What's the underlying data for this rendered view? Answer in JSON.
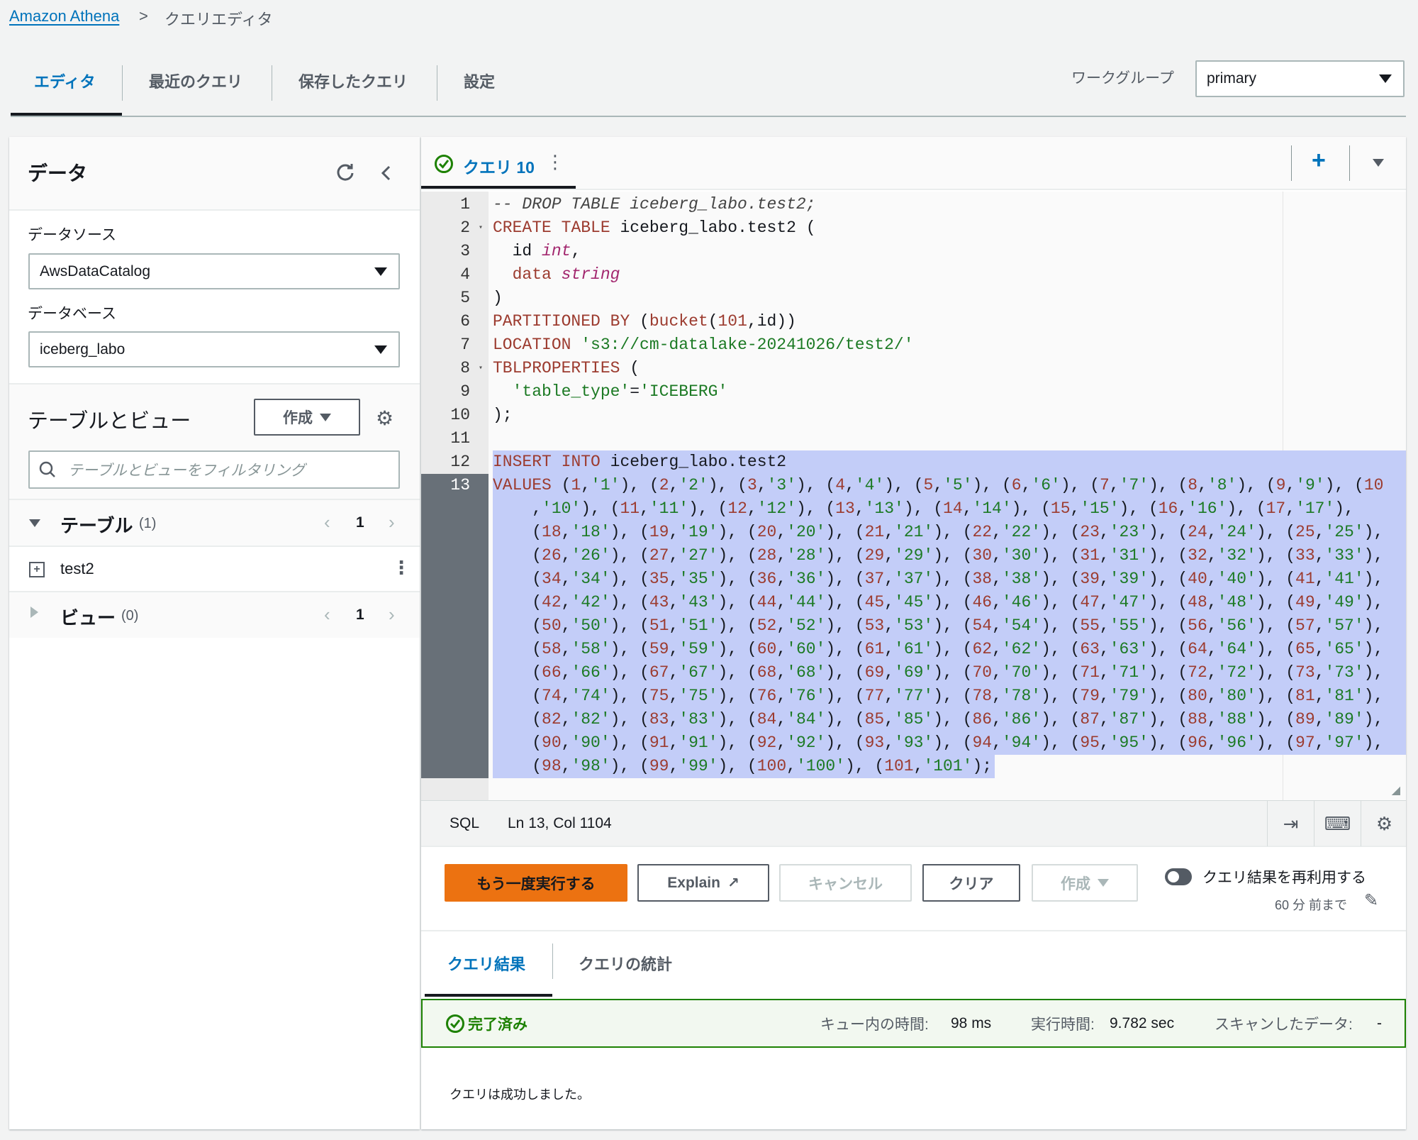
{
  "breadcrumb": {
    "root": "Amazon Athena",
    "separator": ">",
    "current": "クエリエディタ"
  },
  "top_tabs": [
    {
      "label": "エディタ",
      "active": true
    },
    {
      "label": "最近のクエリ"
    },
    {
      "label": "保存したクエリ"
    },
    {
      "label": "設定"
    }
  ],
  "workgroup": {
    "label": "ワークグループ",
    "value": "primary"
  },
  "data_panel": {
    "title": "データ",
    "icons": [
      "refresh-icon",
      "collapse-icon"
    ],
    "datasource_label": "データソース",
    "datasource_value": "AwsDataCatalog",
    "database_label": "データベース",
    "database_value": "iceberg_labo",
    "tables_views_title": "テーブルとビュー",
    "create_label": "作成",
    "filter_placeholder": "テーブルとビューをフィルタリング",
    "tables": {
      "label": "テーブル",
      "count": "(1)",
      "page": "1",
      "items": [
        "test2"
      ]
    },
    "views": {
      "label": "ビュー",
      "count": "(0)",
      "page": "1"
    }
  },
  "editor": {
    "query_tab": "クエリ 10",
    "lines": [
      {
        "n": "1",
        "rows": [
          "-- DROP TABLE iceberg_labo.test2;"
        ]
      },
      {
        "n": "2",
        "fold": true,
        "rows": [
          "CREATE TABLE iceberg_labo.test2 ("
        ]
      },
      {
        "n": "3",
        "rows": [
          "  id int,"
        ]
      },
      {
        "n": "4",
        "rows": [
          "  data string"
        ]
      },
      {
        "n": "5",
        "rows": [
          ")"
        ]
      },
      {
        "n": "6",
        "rows": [
          "PARTITIONED BY (bucket(101,id))"
        ]
      },
      {
        "n": "7",
        "rows": [
          "LOCATION 's3://cm-datalake-20241026/test2/'"
        ]
      },
      {
        "n": "8",
        "fold": true,
        "rows": [
          "TBLPROPERTIES ("
        ]
      },
      {
        "n": "9",
        "rows": [
          "  'table_type'='ICEBERG'"
        ]
      },
      {
        "n": "10",
        "rows": [
          ");"
        ]
      },
      {
        "n": "11",
        "rows": [
          ""
        ]
      },
      {
        "n": "12",
        "rows": [
          "INSERT INTO iceberg_labo.test2"
        ]
      },
      {
        "n": "13",
        "active": true,
        "rows": [
          "VALUES (1,'1'), (2,'2'), (3,'3'), (4,'4'), (5,'5'), (6,'6'), (7,'7'), (8,'8'), (9,'9'), (10",
          "    ,'10'), (11,'11'), (12,'12'), (13,'13'), (14,'14'), (15,'15'), (16,'16'), (17,'17'),",
          "    (18,'18'), (19,'19'), (20,'20'), (21,'21'), (22,'22'), (23,'23'), (24,'24'), (25,'25'),",
          "    (26,'26'), (27,'27'), (28,'28'), (29,'29'), (30,'30'), (31,'31'), (32,'32'), (33,'33'),",
          "    (34,'34'), (35,'35'), (36,'36'), (37,'37'), (38,'38'), (39,'39'), (40,'40'), (41,'41'),",
          "    (42,'42'), (43,'43'), (44,'44'), (45,'45'), (46,'46'), (47,'47'), (48,'48'), (49,'49'),",
          "    (50,'50'), (51,'51'), (52,'52'), (53,'53'), (54,'54'), (55,'55'), (56,'56'), (57,'57'),",
          "    (58,'58'), (59,'59'), (60,'60'), (61,'61'), (62,'62'), (63,'63'), (64,'64'), (65,'65'),",
          "    (66,'66'), (67,'67'), (68,'68'), (69,'69'), (70,'70'), (71,'71'), (72,'72'), (73,'73'),",
          "    (74,'74'), (75,'75'), (76,'76'), (77,'77'), (78,'78'), (79,'79'), (80,'80'), (81,'81'),",
          "    (82,'82'), (83,'83'), (84,'84'), (85,'85'), (86,'86'), (87,'87'), (88,'88'), (89,'89'),",
          "    (90,'90'), (91,'91'), (92,'92'), (93,'93'), (94,'94'), (95,'95'), (96,'96'), (97,'97'),",
          "    (98,'98'), (99,'99'), (100,'100'), (101,'101');"
        ]
      }
    ],
    "status": {
      "language": "SQL",
      "cursor": "Ln 13, Col 1104"
    }
  },
  "actions": {
    "run_again": "もう一度実行する",
    "explain": "Explain",
    "cancel": "キャンセル",
    "clear": "クリア",
    "create": "作成",
    "reuse_label": "クエリ結果を再利用する",
    "reuse_enabled": false,
    "reuse_age": "60 分 前まで"
  },
  "results": {
    "tabs": [
      "クエリ結果",
      "クエリの統計"
    ],
    "status": "完了済み",
    "queue_label": "キュー内の時間:",
    "queue_value": "98 ms",
    "exec_label": "実行時間:",
    "exec_value": "9.782 sec",
    "scan_label": "スキャンしたデータ:",
    "scan_value": "-",
    "message": "クエリは成功しました。"
  },
  "colors": {
    "accent": "#0073bb",
    "primary_button": "#ec7211",
    "success": "#1d8102",
    "selection": "#c3cdf8"
  }
}
